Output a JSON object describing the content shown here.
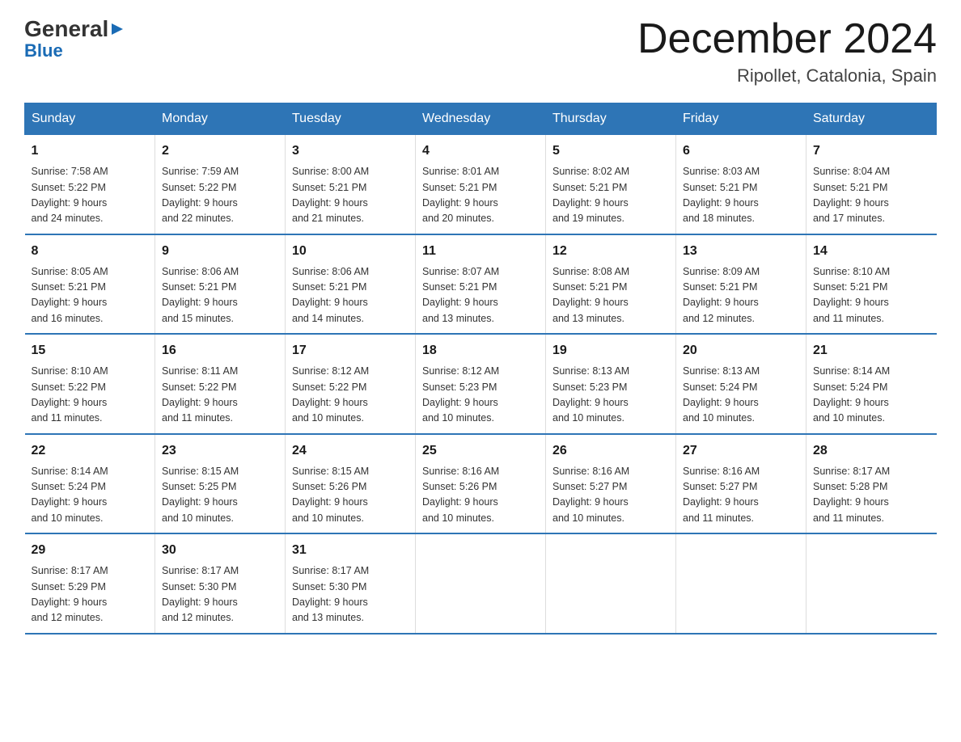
{
  "header": {
    "logo_general": "General",
    "logo_blue": "Blue",
    "month_title": "December 2024",
    "location": "Ripollet, Catalonia, Spain"
  },
  "days_of_week": [
    "Sunday",
    "Monday",
    "Tuesday",
    "Wednesday",
    "Thursday",
    "Friday",
    "Saturday"
  ],
  "weeks": [
    [
      {
        "day": "1",
        "sunrise": "7:58 AM",
        "sunset": "5:22 PM",
        "daylight": "9 hours and 24 minutes."
      },
      {
        "day": "2",
        "sunrise": "7:59 AM",
        "sunset": "5:22 PM",
        "daylight": "9 hours and 22 minutes."
      },
      {
        "day": "3",
        "sunrise": "8:00 AM",
        "sunset": "5:21 PM",
        "daylight": "9 hours and 21 minutes."
      },
      {
        "day": "4",
        "sunrise": "8:01 AM",
        "sunset": "5:21 PM",
        "daylight": "9 hours and 20 minutes."
      },
      {
        "day": "5",
        "sunrise": "8:02 AM",
        "sunset": "5:21 PM",
        "daylight": "9 hours and 19 minutes."
      },
      {
        "day": "6",
        "sunrise": "8:03 AM",
        "sunset": "5:21 PM",
        "daylight": "9 hours and 18 minutes."
      },
      {
        "day": "7",
        "sunrise": "8:04 AM",
        "sunset": "5:21 PM",
        "daylight": "9 hours and 17 minutes."
      }
    ],
    [
      {
        "day": "8",
        "sunrise": "8:05 AM",
        "sunset": "5:21 PM",
        "daylight": "9 hours and 16 minutes."
      },
      {
        "day": "9",
        "sunrise": "8:06 AM",
        "sunset": "5:21 PM",
        "daylight": "9 hours and 15 minutes."
      },
      {
        "day": "10",
        "sunrise": "8:06 AM",
        "sunset": "5:21 PM",
        "daylight": "9 hours and 14 minutes."
      },
      {
        "day": "11",
        "sunrise": "8:07 AM",
        "sunset": "5:21 PM",
        "daylight": "9 hours and 13 minutes."
      },
      {
        "day": "12",
        "sunrise": "8:08 AM",
        "sunset": "5:21 PM",
        "daylight": "9 hours and 13 minutes."
      },
      {
        "day": "13",
        "sunrise": "8:09 AM",
        "sunset": "5:21 PM",
        "daylight": "9 hours and 12 minutes."
      },
      {
        "day": "14",
        "sunrise": "8:10 AM",
        "sunset": "5:21 PM",
        "daylight": "9 hours and 11 minutes."
      }
    ],
    [
      {
        "day": "15",
        "sunrise": "8:10 AM",
        "sunset": "5:22 PM",
        "daylight": "9 hours and 11 minutes."
      },
      {
        "day": "16",
        "sunrise": "8:11 AM",
        "sunset": "5:22 PM",
        "daylight": "9 hours and 11 minutes."
      },
      {
        "day": "17",
        "sunrise": "8:12 AM",
        "sunset": "5:22 PM",
        "daylight": "9 hours and 10 minutes."
      },
      {
        "day": "18",
        "sunrise": "8:12 AM",
        "sunset": "5:23 PM",
        "daylight": "9 hours and 10 minutes."
      },
      {
        "day": "19",
        "sunrise": "8:13 AM",
        "sunset": "5:23 PM",
        "daylight": "9 hours and 10 minutes."
      },
      {
        "day": "20",
        "sunrise": "8:13 AM",
        "sunset": "5:24 PM",
        "daylight": "9 hours and 10 minutes."
      },
      {
        "day": "21",
        "sunrise": "8:14 AM",
        "sunset": "5:24 PM",
        "daylight": "9 hours and 10 minutes."
      }
    ],
    [
      {
        "day": "22",
        "sunrise": "8:14 AM",
        "sunset": "5:24 PM",
        "daylight": "9 hours and 10 minutes."
      },
      {
        "day": "23",
        "sunrise": "8:15 AM",
        "sunset": "5:25 PM",
        "daylight": "9 hours and 10 minutes."
      },
      {
        "day": "24",
        "sunrise": "8:15 AM",
        "sunset": "5:26 PM",
        "daylight": "9 hours and 10 minutes."
      },
      {
        "day": "25",
        "sunrise": "8:16 AM",
        "sunset": "5:26 PM",
        "daylight": "9 hours and 10 minutes."
      },
      {
        "day": "26",
        "sunrise": "8:16 AM",
        "sunset": "5:27 PM",
        "daylight": "9 hours and 10 minutes."
      },
      {
        "day": "27",
        "sunrise": "8:16 AM",
        "sunset": "5:27 PM",
        "daylight": "9 hours and 11 minutes."
      },
      {
        "day": "28",
        "sunrise": "8:17 AM",
        "sunset": "5:28 PM",
        "daylight": "9 hours and 11 minutes."
      }
    ],
    [
      {
        "day": "29",
        "sunrise": "8:17 AM",
        "sunset": "5:29 PM",
        "daylight": "9 hours and 12 minutes."
      },
      {
        "day": "30",
        "sunrise": "8:17 AM",
        "sunset": "5:30 PM",
        "daylight": "9 hours and 12 minutes."
      },
      {
        "day": "31",
        "sunrise": "8:17 AM",
        "sunset": "5:30 PM",
        "daylight": "9 hours and 13 minutes."
      },
      null,
      null,
      null,
      null
    ]
  ],
  "labels": {
    "sunrise": "Sunrise:",
    "sunset": "Sunset:",
    "daylight": "Daylight:"
  }
}
